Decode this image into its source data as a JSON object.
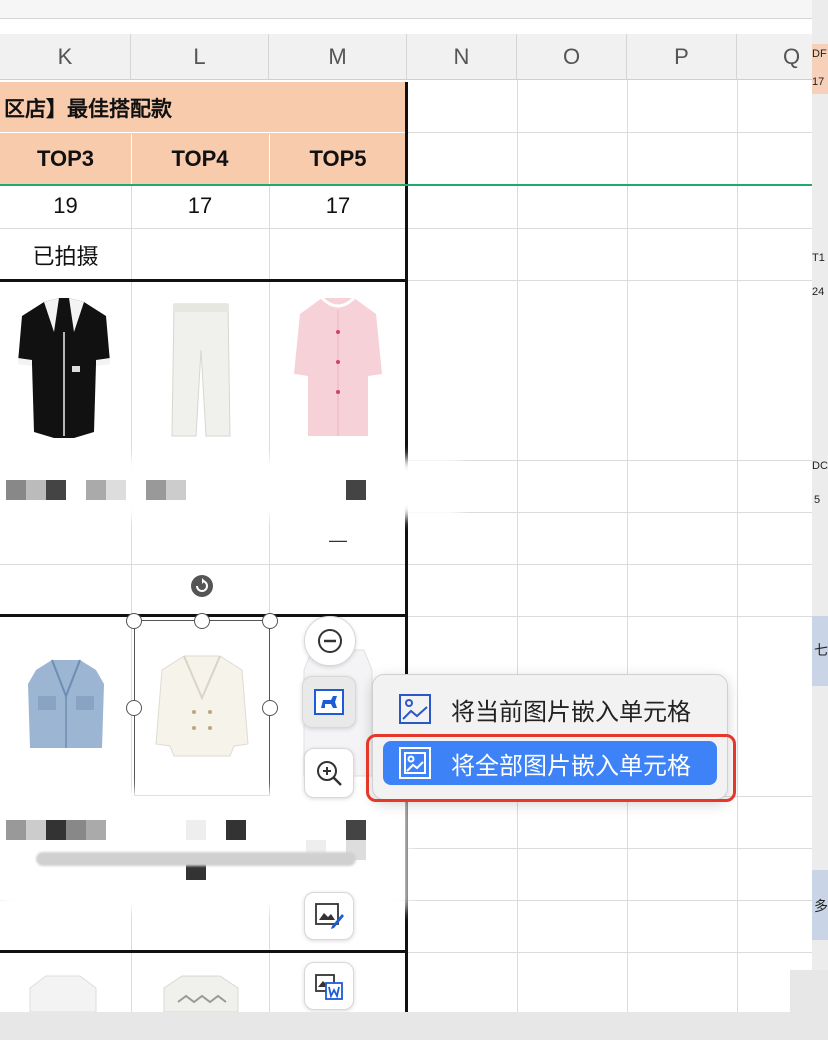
{
  "columns": [
    "K",
    "L",
    "M",
    "N",
    "O",
    "P",
    "Q"
  ],
  "sheet": {
    "title_fragment": "区店】最佳搭配款",
    "headers": [
      "TOP3",
      "TOP4",
      "TOP5"
    ],
    "row1_values": [
      "19",
      "17",
      "17"
    ],
    "row2_values": [
      "已拍摄",
      "",
      ""
    ],
    "row_partial": [
      "",
      "",
      "—"
    ]
  },
  "context_menu": {
    "items": [
      {
        "label": "将当前图片嵌入单元格",
        "icon": "image-embed-icon",
        "selected": false
      },
      {
        "label": "将全部图片嵌入单元格",
        "icon": "image-embed-all-icon",
        "selected": true
      }
    ]
  },
  "right_pane_fragments": [
    "DF",
    "17",
    "T1",
    "24",
    "DC",
    "5",
    "七",
    "多"
  ],
  "colors": {
    "header_fill": "#f8cbad",
    "menu_selected": "#3d82f6",
    "highlight_border": "#e5382b",
    "freeze_line": "#1faa6b"
  }
}
